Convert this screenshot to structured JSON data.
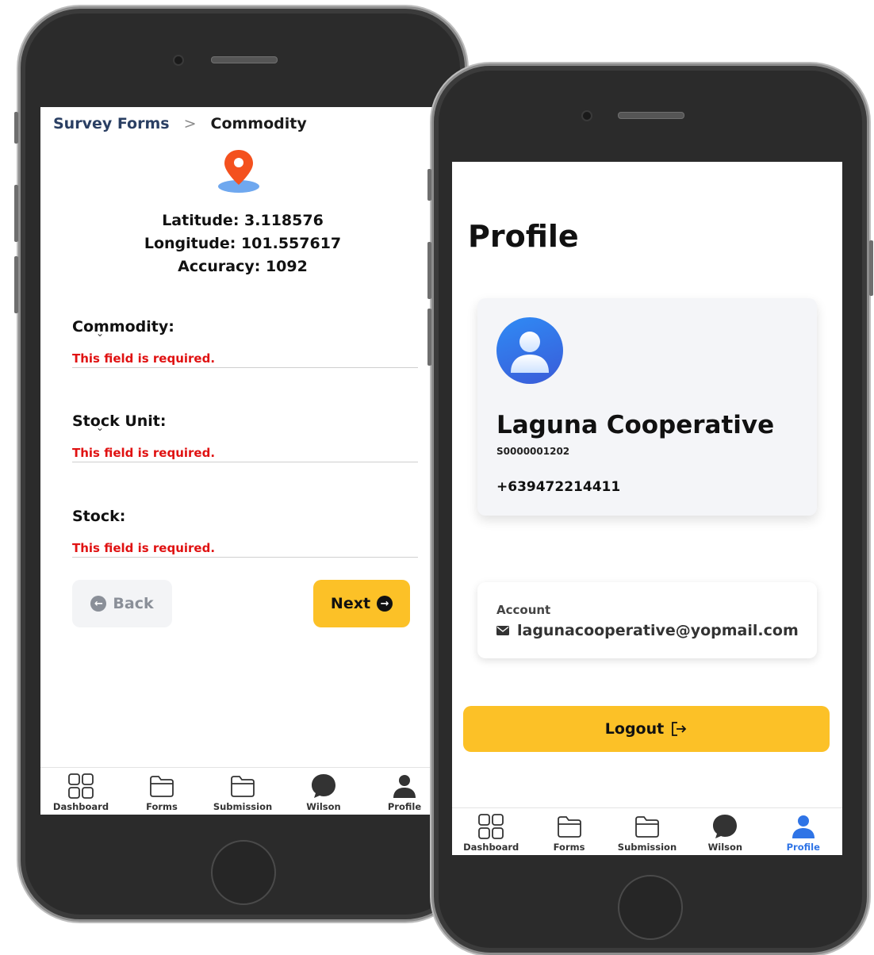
{
  "left_phone": {
    "breadcrumb": {
      "parent": "Survey Forms",
      "separator": ">",
      "current": "Commodity"
    },
    "location": {
      "latitude_text": "Latitude: 3.118576",
      "longitude_text": "Longitude: 101.557617",
      "accuracy_text": "Accuracy: 1092"
    },
    "fields": [
      {
        "label": "Commodity:",
        "error": "This field is required."
      },
      {
        "label": "Stock Unit:",
        "error": "This field is required."
      },
      {
        "label": "Stock:",
        "error": "This field is required."
      }
    ],
    "buttons": {
      "back": "Back",
      "next": "Next"
    }
  },
  "right_phone": {
    "title": "Profile",
    "org_name": "Laguna Cooperative",
    "org_id": "S0000001202",
    "phone": "+639472214411",
    "account": {
      "label": "Account",
      "email": "lagunacooperative@yopmail.com"
    },
    "logout": "Logout"
  },
  "nav": {
    "items": [
      {
        "label": "Dashboard",
        "icon": "grid-icon"
      },
      {
        "label": "Forms",
        "icon": "folder-icon"
      },
      {
        "label": "Submission",
        "icon": "folder-icon"
      },
      {
        "label": "Wilson",
        "icon": "chat-bubble-icon"
      },
      {
        "label": "Profile",
        "icon": "user-icon"
      }
    ]
  },
  "colors": {
    "accent_yellow": "#fcc127",
    "error_red": "#e01212",
    "active_blue": "#2f74e6",
    "crumb_navy": "#2a3f63",
    "pin_orange": "#f4511e"
  }
}
